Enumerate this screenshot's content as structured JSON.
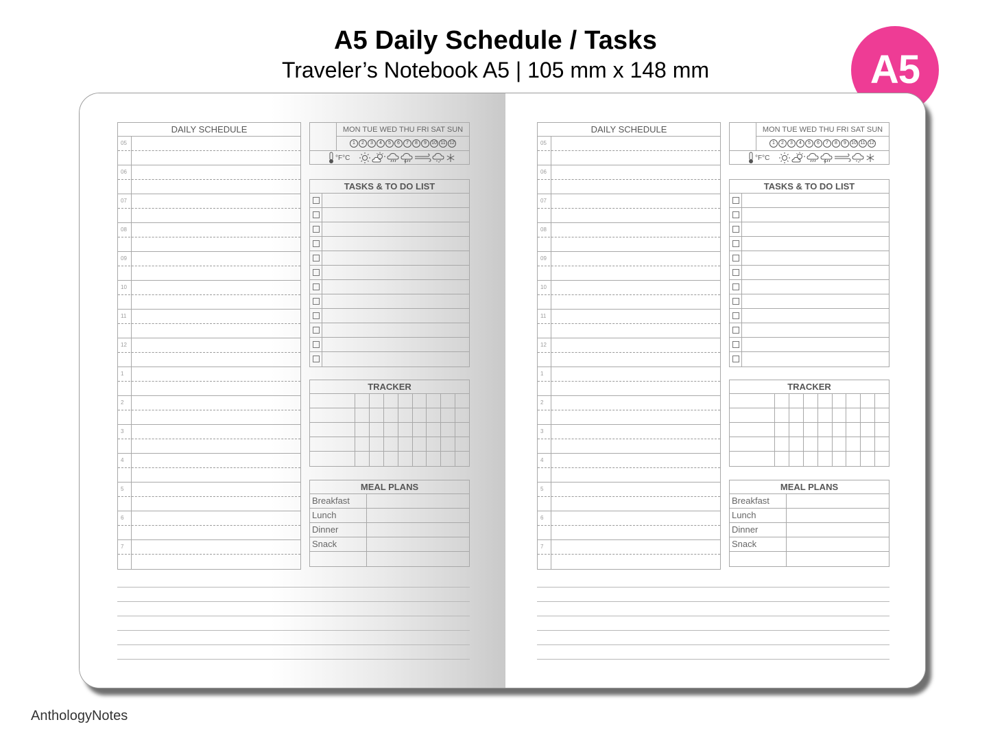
{
  "header": {
    "title": "A5 Daily Schedule / Tasks",
    "subtitle": "Traveler’s Notebook A5 | 105 mm x 148 mm",
    "badge": "A5",
    "badge_color": "#ee3c95"
  },
  "watermark": "AnthologyNotes",
  "pages": [
    {
      "schedule": {
        "title": "DAILY SCHEDULE",
        "hours": [
          "05",
          "06",
          "07",
          "08",
          "09",
          "10",
          "11",
          "12",
          "1",
          "2",
          "3",
          "4",
          "5",
          "6",
          "7"
        ]
      },
      "weekday_box": {
        "days": "MON TUE WED THU FRI SAT SUN",
        "numbers": [
          "1",
          "2",
          "3",
          "4",
          "5",
          "6",
          "7",
          "8",
          "9",
          "10",
          "11",
          "12"
        ],
        "temperature_units": "°F°C",
        "weather_icons": [
          "thermometer-icon",
          "sun-icon",
          "partly-cloudy-icon",
          "rain-icon",
          "storm-icon",
          "wind-icon",
          "snow-cloud-icon",
          "snowflake-icon"
        ]
      },
      "tasks": {
        "title": "TASKS & TO DO LIST",
        "row_count": 12
      },
      "tracker": {
        "title": "TRACKER",
        "rows": 5,
        "day_columns": 8
      },
      "meals": {
        "title": "MEAL PLANS",
        "items": [
          "Breakfast",
          "Lunch",
          "Dinner",
          "Snack",
          ""
        ]
      },
      "notes_lines": 6
    },
    {
      "schedule": {
        "title": "DAILY SCHEDULE",
        "hours": [
          "05",
          "06",
          "07",
          "08",
          "09",
          "10",
          "11",
          "12",
          "1",
          "2",
          "3",
          "4",
          "5",
          "6",
          "7"
        ]
      },
      "weekday_box": {
        "days": "MON TUE WED THU FRI SAT SUN",
        "numbers": [
          "1",
          "2",
          "3",
          "4",
          "5",
          "6",
          "7",
          "8",
          "9",
          "10",
          "11",
          "12"
        ],
        "temperature_units": "°F°C",
        "weather_icons": [
          "thermometer-icon",
          "sun-icon",
          "partly-cloudy-icon",
          "rain-icon",
          "storm-icon",
          "wind-icon",
          "snow-cloud-icon",
          "snowflake-icon"
        ]
      },
      "tasks": {
        "title": "TASKS & TO DO LIST",
        "row_count": 12
      },
      "tracker": {
        "title": "TRACKER",
        "rows": 5,
        "day_columns": 8
      },
      "meals": {
        "title": "MEAL PLANS",
        "items": [
          "Breakfast",
          "Lunch",
          "Dinner",
          "Snack",
          ""
        ]
      },
      "notes_lines": 6
    }
  ]
}
